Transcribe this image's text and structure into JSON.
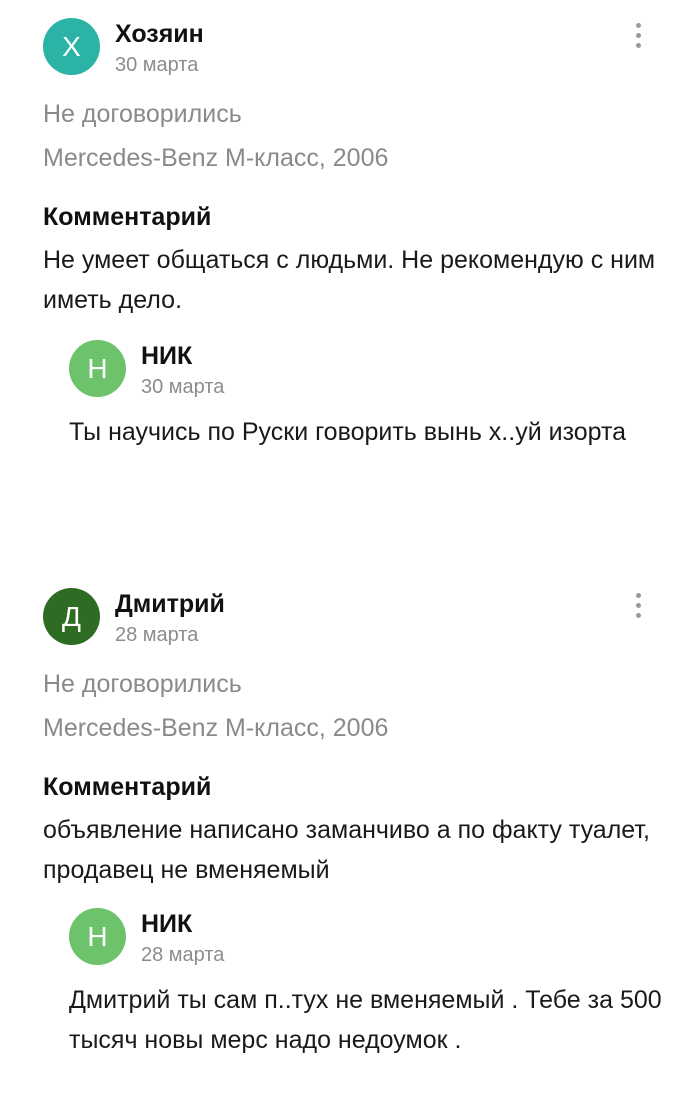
{
  "reviews": [
    {
      "avatar_letter": "Х",
      "avatar_color": "#2bb3a6",
      "author": "Хозяин",
      "date": "30 марта",
      "status": "Не договорились",
      "car": "Mercedes-Benz M-класс, 2006",
      "comment_title": "Комментарий",
      "comment": "Не умеет общаться с людьми. Не рекомендую с ним иметь дело.",
      "reply": {
        "avatar_letter": "Н",
        "author": "НИК",
        "date": "30 марта",
        "text": "Ты научись по Руски говорить вынь х..уй изорта"
      }
    },
    {
      "avatar_letter": "Д",
      "avatar_color": "#2e6b23",
      "author": "Дмитрий",
      "date": "28 марта",
      "status": "Не договорились",
      "car": "Mercedes-Benz M-класс, 2006",
      "comment_title": "Комментарий",
      "comment": "объявление написано заманчиво а по факту туалет, продавец не вменяемый",
      "reply": {
        "avatar_letter": "Н",
        "author": "НИК",
        "date": "28 марта",
        "text": "Дмитрий ты сам п..тух не вменяемый . Тебе за 500 тысяч новы мерс надо недоумок ."
      }
    }
  ]
}
